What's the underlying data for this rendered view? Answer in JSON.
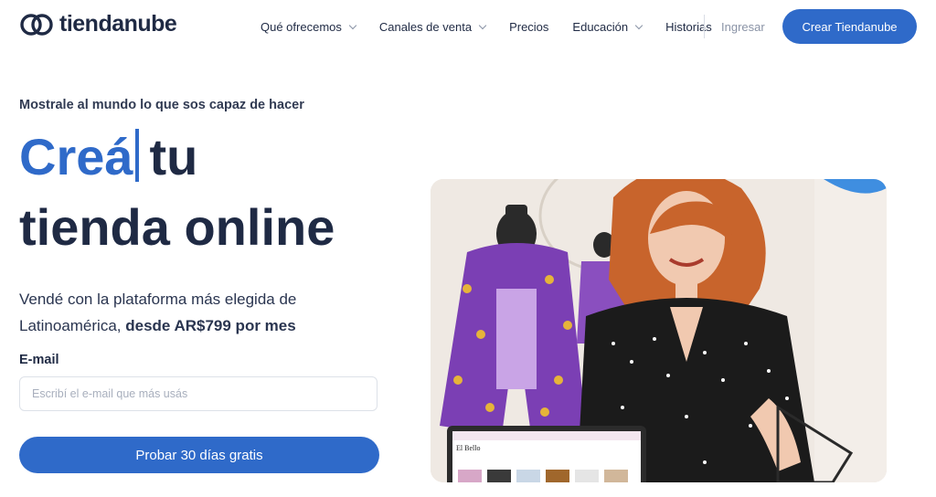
{
  "brand": {
    "name": "tiendanube",
    "accent": "#2f6ac9",
    "text": "#1f2a44"
  },
  "nav": {
    "items": [
      {
        "label": "Qué ofrecemos",
        "has_dropdown": true
      },
      {
        "label": "Canales de venta",
        "has_dropdown": true
      },
      {
        "label": "Precios",
        "has_dropdown": false
      },
      {
        "label": "Educación",
        "has_dropdown": true
      },
      {
        "label": "Historias",
        "has_dropdown": false
      }
    ],
    "login": "Ingresar",
    "cta": "Crear Tiendanube"
  },
  "hero": {
    "eyebrow": "Mostrale al mundo lo que sos capaz de hacer",
    "title_accent": "Creá",
    "title_rest": "tu",
    "title_line2": "tienda online",
    "subtitle_part1": "Vendé con la plataforma más elegida de Latinoamérica, ",
    "subtitle_bold": "desde AR$799 por mes",
    "email_label": "E-mail",
    "email_placeholder": "Escribí el e-mail que más usás",
    "email_value": "",
    "cta": "Probar 30 días gratis"
  },
  "image": {
    "icon": "hero-photo-woman-with-laptop",
    "laptop_store_name": "El Bello"
  }
}
